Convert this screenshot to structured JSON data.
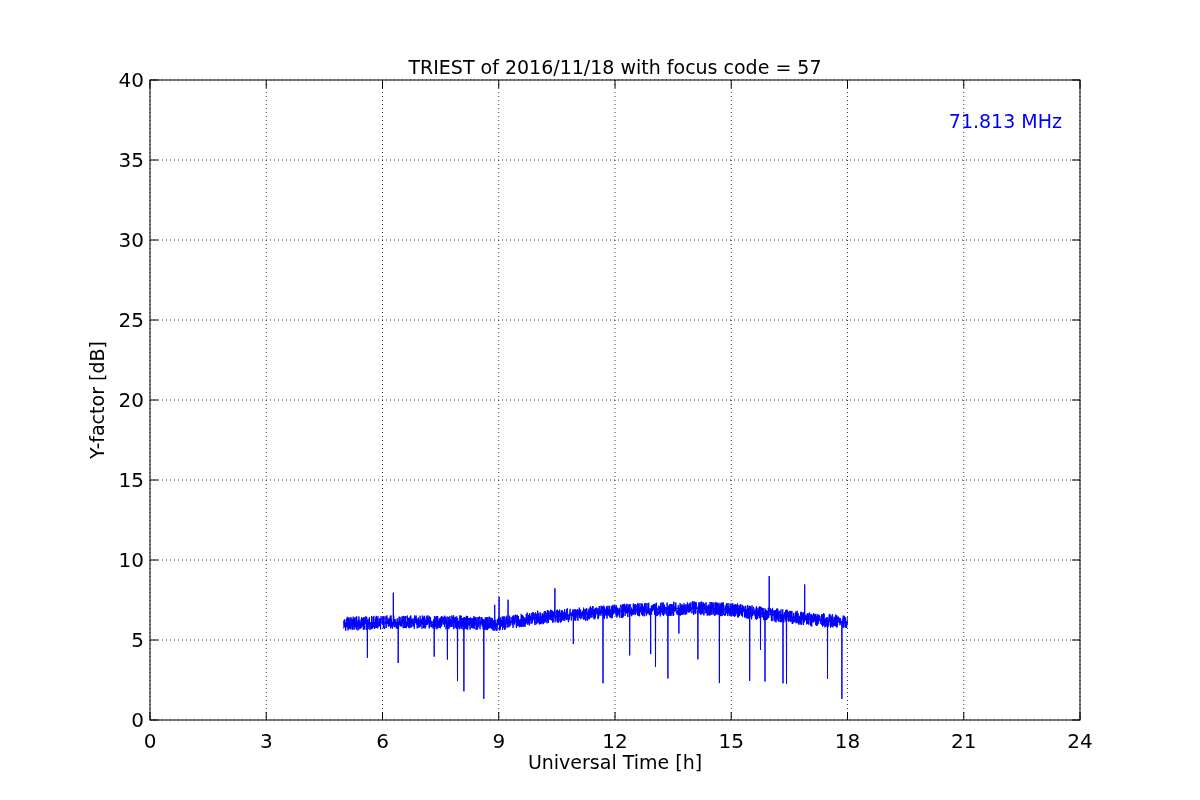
{
  "figure": {
    "chart_data": {
      "type": "line",
      "title": "TRIEST of 2016/11/18 with focus code = 57",
      "xlabel": "Universal Time [h]",
      "ylabel": "Y-factor [dB]",
      "xlim": [
        0,
        24
      ],
      "ylim": [
        0,
        40
      ],
      "grid": true,
      "xticks": [
        0,
        3,
        6,
        9,
        12,
        15,
        18,
        21,
        24
      ],
      "yticks": [
        0,
        5,
        10,
        15,
        20,
        25,
        30,
        35,
        40
      ],
      "series": [
        {
          "name": "71.813 MHz",
          "color": "#0000ff",
          "x": [
            5,
            6,
            7,
            8,
            9,
            10,
            11,
            12,
            13,
            14,
            15,
            16,
            17,
            18
          ],
          "values": [
            6.0,
            6.1,
            6.1,
            6.1,
            6.0,
            6.4,
            6.6,
            6.8,
            6.9,
            7.0,
            6.9,
            6.6,
            6.3,
            6.1
          ]
        }
      ]
    }
  }
}
